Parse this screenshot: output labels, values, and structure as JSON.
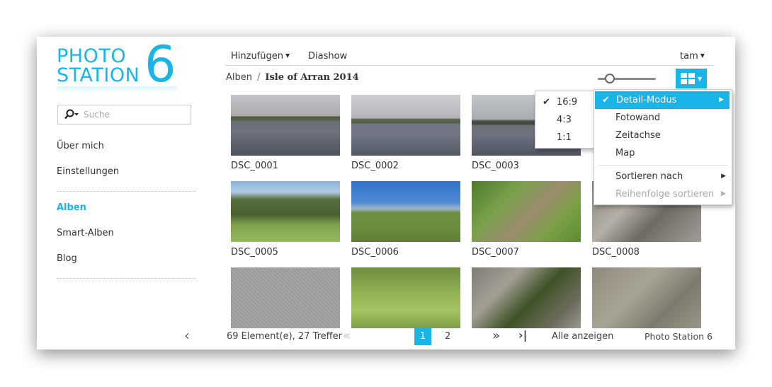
{
  "logo": {
    "line1": "PHOTO",
    "line2": "STATION",
    "version": "6"
  },
  "search": {
    "placeholder": "Suche"
  },
  "sidebar": {
    "items": [
      {
        "label": "Über mich"
      },
      {
        "label": "Einstellungen"
      },
      {
        "label": "Alben"
      },
      {
        "label": "Smart-Alben"
      },
      {
        "label": "Blog"
      }
    ],
    "collapse_glyph": "‹"
  },
  "toolbar": {
    "add_label": "Hinzufügen",
    "slideshow_label": "Diashow",
    "user_label": "tam"
  },
  "breadcrumb": {
    "root": "Alben",
    "separator": "/",
    "current": "Isle of Arran 2014"
  },
  "photos": [
    {
      "name": "DSC_0001"
    },
    {
      "name": "DSC_0002"
    },
    {
      "name": "DSC_0003"
    },
    {
      "name": "DSC_0005"
    },
    {
      "name": "DSC_0006"
    },
    {
      "name": "DSC_0007"
    },
    {
      "name": "DSC_0008"
    },
    {
      "name": ""
    },
    {
      "name": ""
    },
    {
      "name": ""
    },
    {
      "name": ""
    }
  ],
  "footer": {
    "count": "69 Element(e), 27 Treffer",
    "prev_glyph": "«",
    "page1": "1",
    "page2": "2",
    "next_glyph": "»",
    "last_glyph": "›|",
    "show_all": "Alle anzeigen",
    "brand": "Photo Station 6"
  },
  "view_menu": {
    "items": [
      {
        "label": "Detail-Modus"
      },
      {
        "label": "Fotowand"
      },
      {
        "label": "Zeitachse"
      },
      {
        "label": "Map"
      },
      {
        "label": "Sortieren nach"
      },
      {
        "label": "Reihenfolge sortieren"
      }
    ],
    "check_glyph": "✔"
  },
  "aspect_menu": {
    "items": [
      {
        "label": "16:9"
      },
      {
        "label": "4:3"
      },
      {
        "label": "1:1"
      }
    ]
  },
  "colors": {
    "accent": "#19b5e9",
    "text": "#333333",
    "muted": "#aaaaaa"
  }
}
